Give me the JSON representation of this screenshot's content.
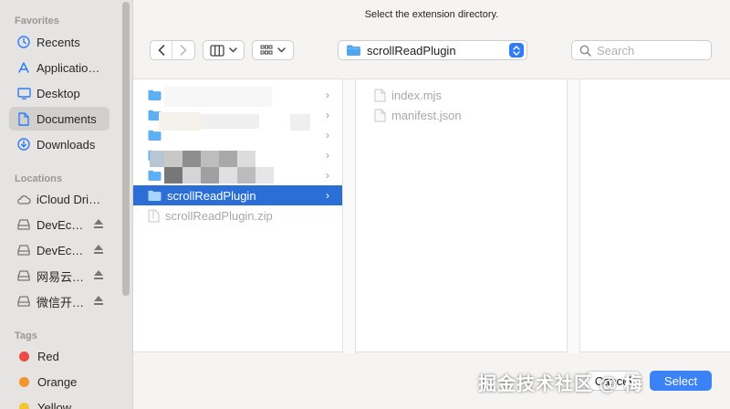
{
  "sidebar": {
    "favorites_heading": "Favorites",
    "favorites": [
      {
        "label": "Recents",
        "icon": "clock-icon"
      },
      {
        "label": "Applicatio…",
        "icon": "applications-icon"
      },
      {
        "label": "Desktop",
        "icon": "desktop-icon"
      },
      {
        "label": "Documents",
        "icon": "document-icon",
        "selected": true
      },
      {
        "label": "Downloads",
        "icon": "download-icon"
      }
    ],
    "locations_heading": "Locations",
    "locations": [
      {
        "label": "iCloud Dri…",
        "icon": "cloud-icon"
      },
      {
        "label": "DevEc…",
        "icon": "disk-icon"
      },
      {
        "label": "DevEc…",
        "icon": "disk-icon"
      },
      {
        "label": "网易云…",
        "icon": "disk-icon"
      },
      {
        "label": "微信开…",
        "icon": "disk-icon"
      }
    ],
    "tags_heading": "Tags",
    "tags": [
      {
        "label": "Red",
        "color": "#ec4b42"
      },
      {
        "label": "Orange",
        "color": "#f0962c"
      },
      {
        "label": "Yellow",
        "color": "#f2c631"
      }
    ]
  },
  "dialog": {
    "prompt": "Select the extension directory."
  },
  "toolbar": {
    "path": "scrollReadPlugin",
    "search_placeholder": "Search"
  },
  "browser": {
    "column1": [
      {
        "label": "",
        "type": "folder"
      },
      {
        "label": "",
        "type": "folder"
      },
      {
        "label": "",
        "type": "folder"
      },
      {
        "label": "",
        "type": "folder"
      },
      {
        "label": "",
        "type": "folder"
      },
      {
        "label": "scrollReadPlugin",
        "type": "folder",
        "selected": true
      },
      {
        "label": "scrollReadPlugin.zip",
        "type": "file",
        "dimmed": true
      }
    ],
    "column2": [
      {
        "label": "index.mjs",
        "type": "file"
      },
      {
        "label": "manifest.json",
        "type": "file"
      }
    ]
  },
  "buttons": {
    "cancel": "Cancel",
    "select": "Select"
  },
  "watermark": "掘金技术社区 @ 梅",
  "colors": {
    "accent": "#2b6fd6",
    "select_button": "#3b82f6"
  }
}
